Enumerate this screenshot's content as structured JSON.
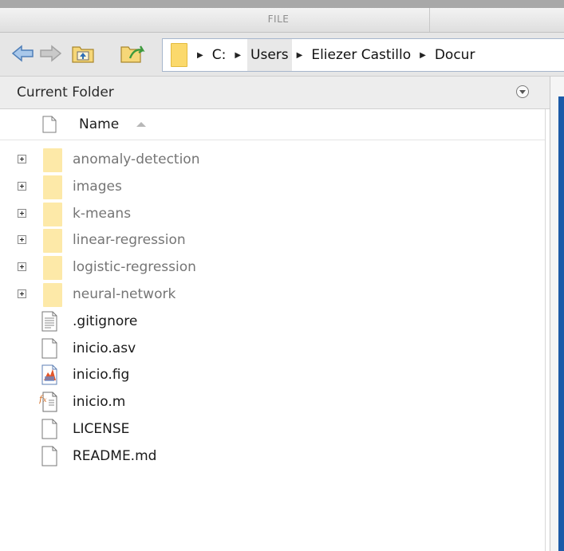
{
  "ribbon": {
    "tab_file": "FILE"
  },
  "toolbar": {
    "icons": [
      "back-arrow-icon",
      "forward-arrow-icon",
      "up-folder-icon",
      "browse-folder-icon"
    ],
    "address": {
      "crumbs": [
        "C:",
        "Users",
        "Eliezer Castillo",
        "Docur"
      ]
    }
  },
  "panel": {
    "title": "Current Folder",
    "column_name": "Name",
    "items": [
      {
        "label": "anomaly-detection",
        "type": "folder"
      },
      {
        "label": "images",
        "type": "folder"
      },
      {
        "label": "k-means",
        "type": "folder"
      },
      {
        "label": "linear-regression",
        "type": "folder"
      },
      {
        "label": "logistic-regression",
        "type": "folder"
      },
      {
        "label": "neural-network",
        "type": "folder"
      },
      {
        "label": ".gitignore",
        "type": "text-file"
      },
      {
        "label": "inicio.asv",
        "type": "blank-file"
      },
      {
        "label": "inicio.fig",
        "type": "fig-file"
      },
      {
        "label": "inicio.m",
        "type": "m-file"
      },
      {
        "label": "LICENSE",
        "type": "blank-file"
      },
      {
        "label": "README.md",
        "type": "blank-file"
      }
    ]
  },
  "colors": {
    "folder": "#fde9a8",
    "address_folder": "#fbd96c",
    "accent_blue": "#1b5aa8",
    "header_bg": "#ededed"
  }
}
